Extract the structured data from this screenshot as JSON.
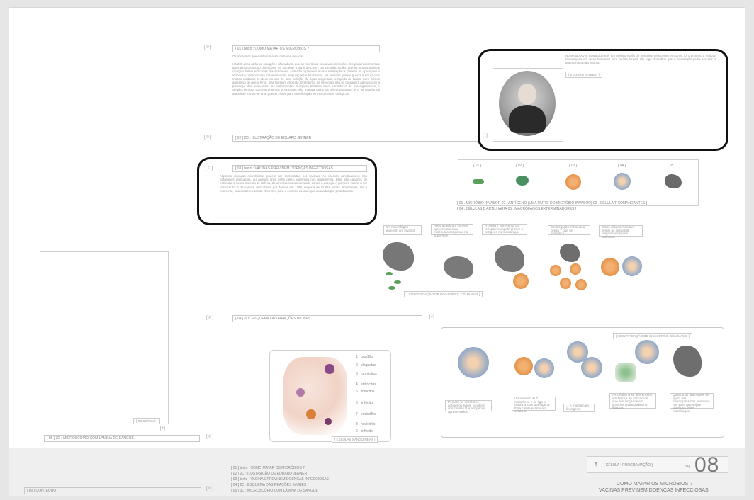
{
  "intro": {
    "index": "[ 0 ]",
    "label": "[ 01 ]   texto : COMO MATAR OS MICRÓBIOS ?",
    "lead": "Os micróbios que existem matam milhares de vidas.",
    "body": "Há 200 anos atrás os cirurgiões não sabiam que os micróbios causavam infecções. Os pacientes morriam após as cirurgias por infecções. Só somente a partir de Lister, um cirurgião inglês, que as mortes após as cirurgias foram reduzidas drasticamente. Lister foi o primeiro a usar antissépticos durante as operações e introduziu o fenol como tratamento nas amputações e ferimentos. Na primeira grande guerra a solução de muitos soldados se deve ao uso de uma solução de água oxigenada, o líquido de Dakin, bem menos agressivo do que o fenol, mas também eficiente. Entretanto, as infecções não se propagam apenas com a presença dos ferimentos. Os instrumentos cirúrgicos também eram portadores de microrganismos. A simples fervura dos instrumentos e esponjas não matava todos os microrganismos, e a introdução da autoclave tornou-se uma grande chave para esterilização de instrumentos cirúrgicos."
  },
  "jenner_row": {
    "index": "[ 0 ]",
    "label": "[ 02 ]   2D : ILUSTRAÇÃO DE EDUARD JENNER",
    "plus": "[+]"
  },
  "portrait": {
    "caption": "No século XVIII, Edward Jenner um médico inglês de Berkeley, Gloucester em 1796, foi o primeiro a realizar inoculações em seres humanos com varíola bovina. Ele logo descobriu que a inoculação podia prevenir o aparecimento da varíola.",
    "name_tag": "[ EDUARD JENNER ]"
  },
  "vaccines": {
    "index": "[ 0 ]",
    "label": "[ 03 ]   texto : VACINAS PREVINEM DOENÇAS INFECCIOSAS",
    "body": "Algumas doenças microbianas podem ser controladas por vacinas. As vacinas constituem-se nos patógenos atenuados, ou apenas uma parte deles, inativada nos organismos. Elas são capazes de estimular o nosso sistema de defesa, desenvolvendo a imunidade contra a doença. A primeira vacina a ser utilizada foi a da varíola, descoberta por Jenner em 1796, seguida de muitas outras. Atualmente, até o momento, não existem vacinas eficientes para o controle de doenças causadas por protozoários."
  },
  "legend": {
    "items": [
      "[ 01 ]",
      "[ 02 ]",
      "[ 03 ]",
      "[ 04 ]",
      "[ 05 ]"
    ],
    "line1": "[ 01 . MICRÓBIO INVASOR    02 . ANTÍGENO (UMA PARTE DO MICRÓBIO INVASOR)    03 . CÉLULA T COMANDANTES ]",
    "line2": "[ 04 . CÉLULAS B ARTILHARIA    05 . MACRÓFAGOS EXTERMINADORES ]"
  },
  "sequence1": {
    "steps": [
      "Os macrófagos ingerem um invasor.",
      "Após digerir um invasor apresentam suas moléculas antigenas na superfície.",
      "A célula T apresenta um receptor compatível com o antígeno no macrófago.",
      "Essa ligação estimula a célula T que se multiplica.",
      "Estas células mandam avisar as células B responsáveis pela artilharia."
    ],
    "title": "[ IDENTIFICAÇÃO DE INVASORES: CÉLULAS T ]"
  },
  "scheme_row": {
    "index": "[ 0 ]",
    "label": "[ 04 ]   2D : ESQUEMA DAS REAÇÕES IMUNES",
    "plus": "[+]"
  },
  "sequence2": {
    "title": "[ IDENTIFICAÇÃO DE INVASORES: CÉLULAS B ]",
    "steps": [
      "Perante os micróbios, antígenos livres, recebem dos células B e antígenos apresentados.",
      "Uma molécula T reconhece e se liga a célula B com o antígeno. Esta célula estimula a célula B.",
      "... e multiplicam linhagens.",
      "As células B se diferenciam em fábrica de anticorpos que são lançados em grandes quantidades no sangue.",
      "Quando os anticorpos se ligam aos microrganismos, marcam-nos para que sejam digeridos pelos macrófagos."
    ]
  },
  "blood": {
    "labels": [
      "1 . basófilo",
      "2 . plaquetas",
      "3 . monócitos",
      "4 . eritrócitos",
      "5 . linfócitos",
      "6 . linfócito",
      "7 . eosinófilo",
      "8 . neutrófilo",
      "9 . linfócito"
    ],
    "title": "[ CÉLULAS SANGUÍNEAS ]"
  },
  "observe": {
    "label": "[ OBSERVAR ]",
    "plus": "[+]"
  },
  "microscope_row": {
    "label": "[ 05 ]   3D : MICROSCÓPIO COM LÂMINA DE SANGUE",
    "index": "[ 0 ]"
  },
  "footer": {
    "contents": "[ 00 ]   CONTEÚDO",
    "index": "[ 0 ]",
    "list": [
      "[ 01 ]   texto : COMO MATAR OS MICRÓBIOS ?",
      "[ 02 ]   2D : ILUSTRAÇÃO DE EDUARD JENNER",
      "[ 03 ]   texto : VACINAS PREVINEM DOENÇAS INFECCIOSAS",
      "[ 04 ]   2D : ESQUEMA DAS REAÇÕES IMUNES",
      "[ 05 ]   3D : MICROSCÓPIO COM LÂMINA DE SANGUE"
    ],
    "nav_label": "[ CÉLULA : PROGRAMAÇÃO ]",
    "page_prefix": "pág",
    "page_number": "08",
    "title_line1": "COMO MATAR OS MICRÓBIOS ?",
    "title_line2": "VACINAS PREVINEM DOENÇAS INFECCIOSAS"
  }
}
